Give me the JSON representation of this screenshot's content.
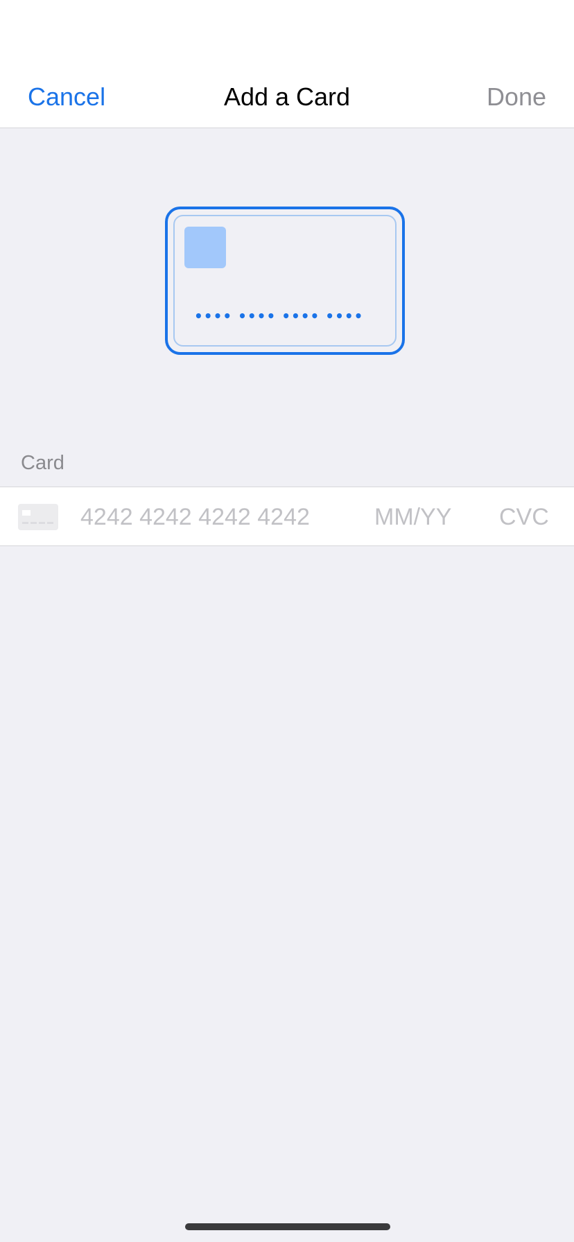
{
  "colors": {
    "accent": "#1a73e8",
    "background": "#f0f0f5",
    "placeholder": "#c1c1c5",
    "done_disabled": "#8e8e93"
  },
  "nav": {
    "cancel_label": "Cancel",
    "title": "Add a Card",
    "done_label": "Done"
  },
  "card_preview": {
    "number_mask": "•••• •••• •••• ••••"
  },
  "section": {
    "label": "Card"
  },
  "card_fields": {
    "brand_icon": "generic-card-icon",
    "number": {
      "value": "",
      "placeholder": "4242 4242 4242 4242"
    },
    "expiry": {
      "value": "",
      "placeholder": "MM/YY"
    },
    "cvc": {
      "value": "",
      "placeholder": "CVC"
    }
  }
}
